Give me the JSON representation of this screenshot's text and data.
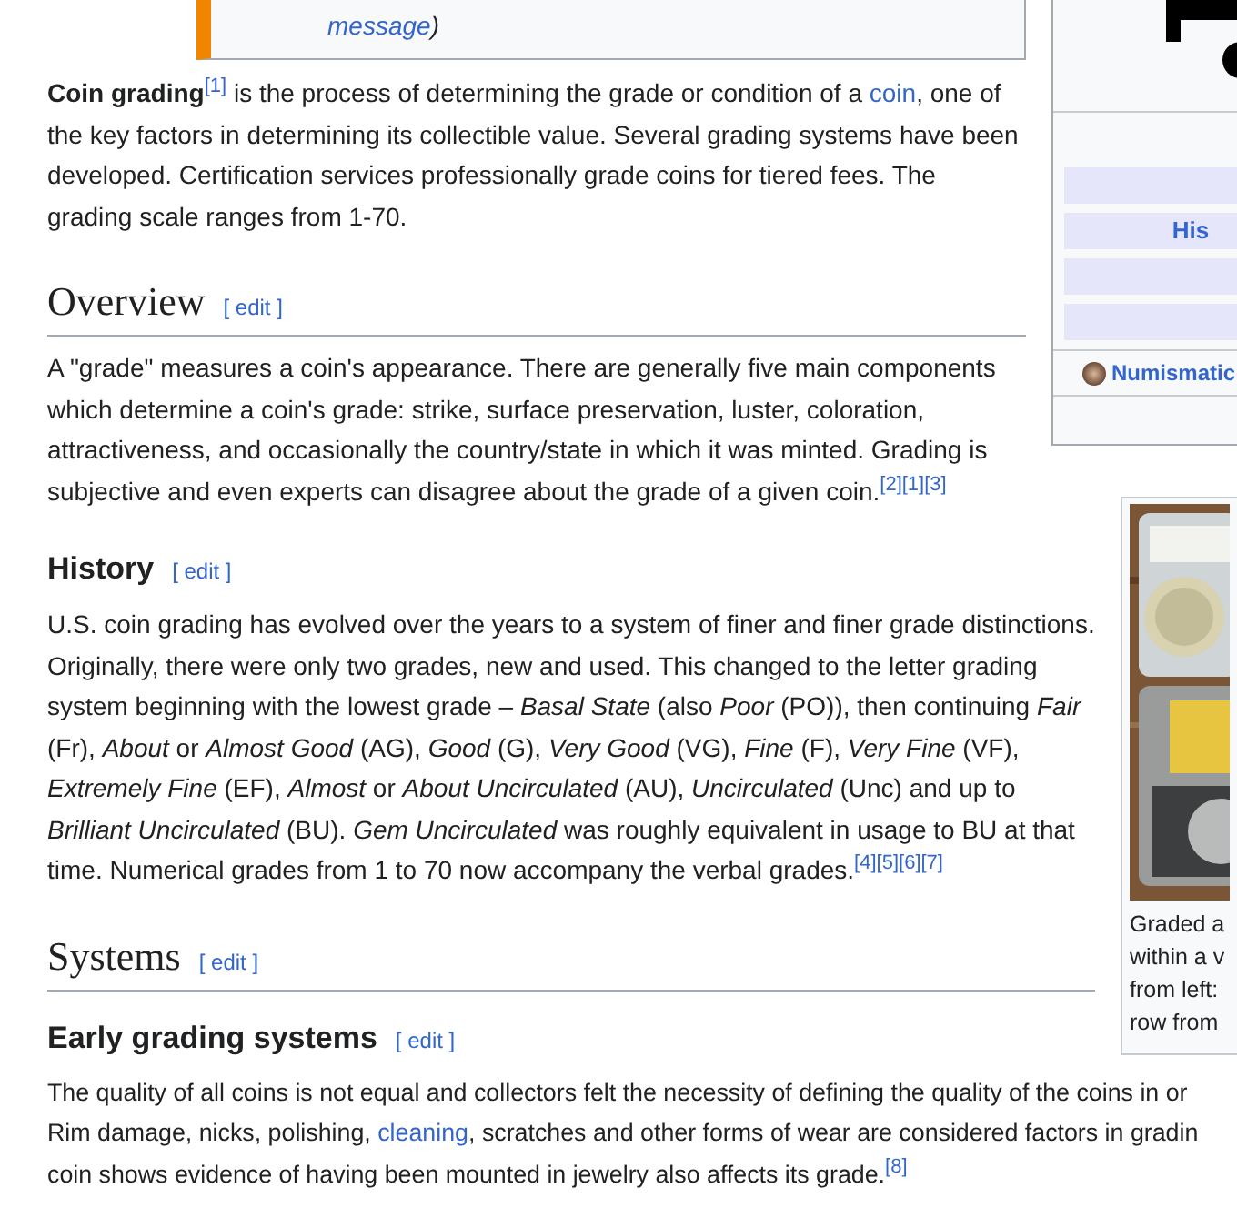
{
  "notice": {
    "link": "message",
    "after": ")"
  },
  "infobox": {
    "rows": [
      {
        "kind": "blank"
      },
      {
        "kind": "nav"
      },
      {
        "kind": "nav",
        "label": "His"
      },
      {
        "kind": "nav"
      },
      {
        "kind": "nav"
      },
      {
        "kind": "portal",
        "label": "Numismatic"
      },
      {
        "kind": "blank"
      }
    ]
  },
  "intro": [
    {
      "kind": "bold",
      "text": "Coin grading"
    },
    {
      "kind": "ref",
      "text": "[1]"
    },
    {
      "kind": "text",
      "text": " is the process of determining the grade or condition of a "
    },
    {
      "kind": "link",
      "text": "coin"
    },
    {
      "kind": "text",
      "text": ", one of the key factors in determining its collectible value. Several grading systems have been developed. Certification services professionally grade coins for tiered fees. The grading scale ranges from 1-70."
    }
  ],
  "thumb": {
    "caption_lines": [
      "Graded a",
      "within a v",
      "from left:",
      "row from"
    ]
  },
  "sections": [
    {
      "kind": "h2",
      "heading": "Overview",
      "edit": "[ edit ]",
      "paragraphs": [
        [
          {
            "kind": "text",
            "text": "A \"grade\" measures a coin's appearance. There are generally five main components which determine a coin's grade: strike, surface preservation, luster, coloration, attractiveness, and occasionally the country/state in which it was minted. Grading is subjective and even experts can disagree about the grade of a given coin."
          },
          {
            "kind": "ref",
            "text": "[2]"
          },
          {
            "kind": "ref",
            "text": "[1]"
          },
          {
            "kind": "ref",
            "text": "[3]"
          }
        ]
      ]
    },
    {
      "kind": "h3",
      "heading": "History",
      "edit": "[ edit ]",
      "paragraphs": [
        [
          {
            "kind": "text",
            "text": "U.S. coin grading has evolved over the years to a system of finer and finer grade distinctions. Originally, there were only two grades, new and used. This changed to the letter grading system beginning with the lowest grade – *Basal State* (also *Poor* (PO)), then continuing *Fair* (Fr), *About* or *Almost Good* (AG), *Good* (G), *Very Good* (VG), *Fine* (F), *Very Fine* (VF), *Extremely Fine* (EF), *Almost* or *About Uncirculated* (AU), *Uncirculated* (Unc) and up to *Brilliant Uncirculated* (BU). *Gem Uncirculated* was roughly equivalent in usage to BU at that time. Numerical grades from 1 to 70 now accompany the verbal grades."
          },
          {
            "kind": "ref",
            "text": "[4]"
          },
          {
            "kind": "ref",
            "text": "[5]"
          },
          {
            "kind": "ref",
            "text": "[6]"
          },
          {
            "kind": "ref",
            "text": "[7]"
          }
        ]
      ]
    },
    {
      "kind": "h2",
      "heading": "Systems",
      "edit": "[ edit ]"
    },
    {
      "kind": "h3",
      "heading": "Early grading systems",
      "edit": "[ edit ]",
      "lines": [
        [
          {
            "kind": "text",
            "text": "The quality of all coins is not equal and collectors felt the necessity of defining the quality of the coins in or"
          }
        ],
        [
          {
            "kind": "text",
            "text": "Rim damage, nicks, polishing, "
          },
          {
            "kind": "link",
            "text": "cleaning"
          },
          {
            "kind": "text",
            "text": ", scratches and other forms of wear are considered factors in gradin"
          }
        ],
        [
          {
            "kind": "text",
            "text": "coin shows evidence of having been mounted in jewelry also affects its grade."
          },
          {
            "kind": "ref",
            "text": "[8]"
          }
        ]
      ]
    }
  ]
}
